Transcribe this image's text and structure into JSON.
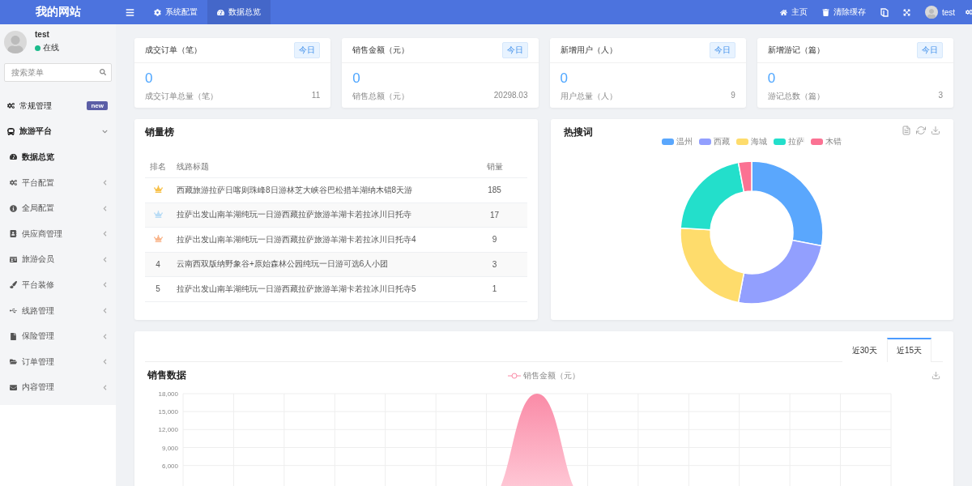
{
  "header": {
    "brand": "我的网站",
    "tabs": [
      {
        "label": "系统配置",
        "selected": false
      },
      {
        "label": "数据总览",
        "selected": true
      }
    ],
    "actions": [
      {
        "label": "主页"
      },
      {
        "label": "清除缓存"
      }
    ],
    "user": "test"
  },
  "sidebar": {
    "user": {
      "name": "test",
      "status": "在线"
    },
    "search": {
      "placeholder": "搜索菜单"
    },
    "items": [
      {
        "label": "常规管理",
        "badge": "new"
      },
      {
        "label": "旅游平台",
        "expanded": true,
        "children": [
          {
            "label": "数据总览",
            "selected": true
          },
          {
            "label": "平台配置",
            "selected": false,
            "expanded": false
          },
          {
            "label": "全局配置",
            "selected": false,
            "expanded": false
          },
          {
            "label": "供应商管理",
            "selected": false,
            "expanded": false
          },
          {
            "label": "旅游会员",
            "selected": false,
            "expanded": false
          },
          {
            "label": "平台装修",
            "selected": false,
            "expanded": false
          },
          {
            "label": "线路管理",
            "selected": false,
            "expanded": false
          },
          {
            "label": "保险管理",
            "selected": false,
            "expanded": false
          },
          {
            "label": "订单管理",
            "selected": false,
            "expanded": false
          },
          {
            "label": "内容管理",
            "selected": false,
            "expanded": false
          }
        ]
      }
    ]
  },
  "stats": [
    {
      "title": "成交订单（笔）",
      "badge": "今日",
      "value": "0",
      "total_label": "成交订单总量（笔）",
      "total": "11"
    },
    {
      "title": "销售金额（元）",
      "badge": "今日",
      "value": "0",
      "total_label": "销售总额（元）",
      "total": "20298.03"
    },
    {
      "title": "新增用户（人）",
      "badge": "今日",
      "value": "0",
      "total_label": "用户总量（人）",
      "total": "9"
    },
    {
      "title": "新增游记（篇）",
      "badge": "今日",
      "value": "0",
      "total_label": "游记总数（篇）",
      "total": "3"
    }
  ],
  "ranking": {
    "title": "销量榜",
    "columns": [
      "排名",
      "线路标题",
      "销量"
    ],
    "rows": [
      {
        "kind": "crown",
        "color": "#f7c14a",
        "title": "西藏旅游拉萨日喀则珠峰8日游林芝大峡谷巴松措羊湖纳木错8天游",
        "sales": "185"
      },
      {
        "kind": "crown",
        "color": "#b9dcf5",
        "title": "拉萨出发山南羊湖纯玩一日游西藏拉萨旅游羊湖卡若拉冰川日托寺",
        "sales": "17"
      },
      {
        "kind": "crown",
        "color": "#f9b58b",
        "title": "拉萨出发山南羊湖纯玩一日游西藏拉萨旅游羊湖卡若拉冰川日托寺4",
        "sales": "9"
      },
      {
        "kind": "number",
        "rank": "4",
        "title": "云南西双版纳野象谷+原始森林公园纯玩一日游可选6人小团",
        "sales": "3"
      },
      {
        "kind": "number",
        "rank": "5",
        "title": "拉萨出发山南羊湖纯玩一日游西藏拉萨旅游羊湖卡若拉冰川日托寺5",
        "sales": "1"
      }
    ]
  },
  "hot_words": {
    "title": "热搜词",
    "legend": [
      {
        "name": "温州",
        "color": "#5aa7fd"
      },
      {
        "name": "西藏",
        "color": "#929ffe"
      },
      {
        "name": "海城",
        "color": "#fedc6c"
      },
      {
        "name": "拉萨",
        "color": "#23dfcb"
      },
      {
        "name": "木错",
        "color": "#fb7293"
      }
    ]
  },
  "sales": {
    "title": "销售数据",
    "tabs": [
      {
        "label": "近30天",
        "selected": false
      },
      {
        "label": "近15天",
        "selected": true
      }
    ],
    "chart_data": {
      "type": "area",
      "grid": true,
      "ylim": [
        0,
        18000
      ],
      "yticks": [
        {
          "value": 6000,
          "label": "6,000"
        },
        {
          "value": 9000,
          "label": "9,000"
        },
        {
          "value": 12000,
          "label": "12,000"
        },
        {
          "value": 15000,
          "label": "15,000"
        },
        {
          "value": 18000,
          "label": "18,000"
        }
      ],
      "series": [
        {
          "name": "销售金额（元）",
          "color": "#fa8ba7",
          "values": [
            0,
            0,
            0,
            0,
            0,
            0,
            0,
            18000,
            0,
            0,
            0,
            0,
            0,
            0,
            0
          ]
        }
      ]
    }
  }
}
